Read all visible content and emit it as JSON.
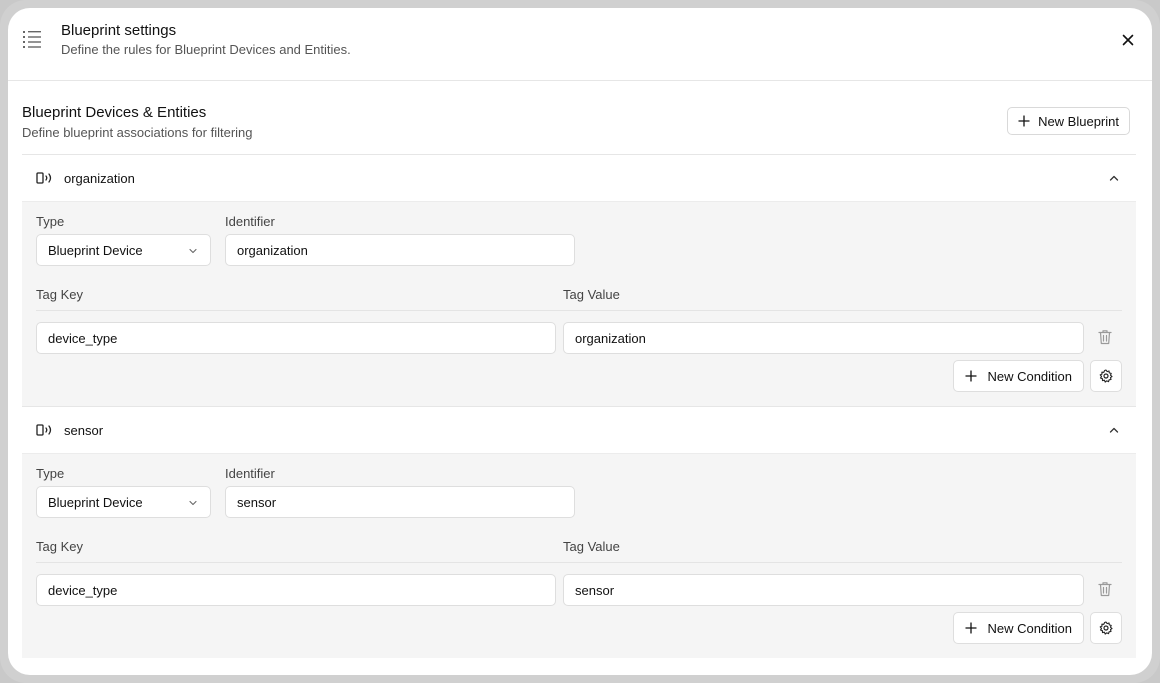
{
  "header": {
    "title": "Blueprint settings",
    "subtitle": "Define the rules for Blueprint Devices and Entities."
  },
  "section": {
    "title": "Blueprint Devices & Entities",
    "subtitle": "Define blueprint associations for filtering",
    "new_button": "New Blueprint"
  },
  "blueprints": [
    {
      "name": "organization",
      "type_label": "Type",
      "type_value": "Blueprint Device",
      "identifier_label": "Identifier",
      "identifier_value": "organization",
      "tag_key_label": "Tag Key",
      "tag_value_label": "Tag Value",
      "tag_key": "device_type",
      "tag_value": "organization",
      "new_condition": "New Condition"
    },
    {
      "name": "sensor",
      "type_label": "Type",
      "type_value": "Blueprint Device",
      "identifier_label": "Identifier",
      "identifier_value": "sensor",
      "tag_key_label": "Tag Key",
      "tag_value_label": "Tag Value",
      "tag_key": "device_type",
      "tag_value": "sensor",
      "new_condition": "New Condition"
    }
  ],
  "icons": {
    "header": "list-icon",
    "close": "close-icon",
    "device": "device-broadcast-icon",
    "collapse": "chevron-up-icon",
    "dropdown": "chevron-down-icon",
    "delete": "trash-icon",
    "add": "plus-icon",
    "settings": "gear-icon"
  }
}
